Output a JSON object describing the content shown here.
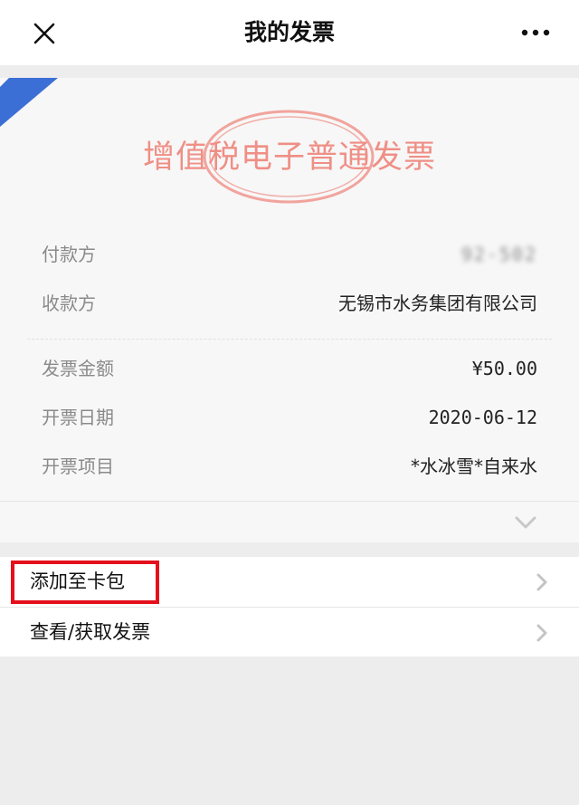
{
  "header": {
    "title": "我的发票",
    "close_icon": "close-icon",
    "more_icon": "more-icon"
  },
  "invoice": {
    "title": "增值税电子普通发票",
    "rows": [
      {
        "label": "付款方",
        "value": "92-502",
        "obscured": true
      },
      {
        "label": "收款方",
        "value": "无锡市水务集团有限公司"
      },
      {
        "label": "发票金额",
        "value": "¥50.00"
      },
      {
        "label": "开票日期",
        "value": "2020-06-12"
      },
      {
        "label": "开票项目",
        "value": "*水冰雪*自来水"
      }
    ],
    "title_color": "#ef8f86",
    "ribbon_color": "#3c6fd6"
  },
  "actions": {
    "add_to_wallet": "添加至卡包",
    "view_invoice": "查看/获取发票"
  },
  "highlight_color": "#e4101c"
}
